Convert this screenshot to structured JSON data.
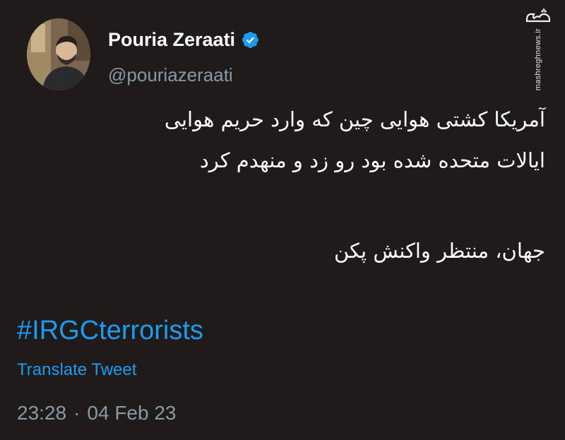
{
  "author": {
    "display_name": "Pouria Zeraati",
    "handle": "@pouriazeraati",
    "verified": true,
    "verified_color": "#1d9bf0",
    "avatar_icon": "profile-photo"
  },
  "tweet": {
    "lines": [
      "آمریکا کشتی هوایی چین که وارد حریم هوایی",
      "ایالات متحده شده بود رو زد و منهدم کرد",
      "جهان، منتظر واکنش پکن"
    ],
    "hashtag": "#IRGCterrorists",
    "translate_label": "Translate Tweet",
    "time": "23:28",
    "separator": "·",
    "date": "04 Feb 23"
  },
  "watermark": {
    "logo_text": "مشرق",
    "site": "mashreghnews.ir"
  },
  "colors": {
    "background": "#1f1b1a",
    "link": "#1d9bf0",
    "secondary_text": "#8b98a5",
    "primary_text": "#ffffff"
  }
}
